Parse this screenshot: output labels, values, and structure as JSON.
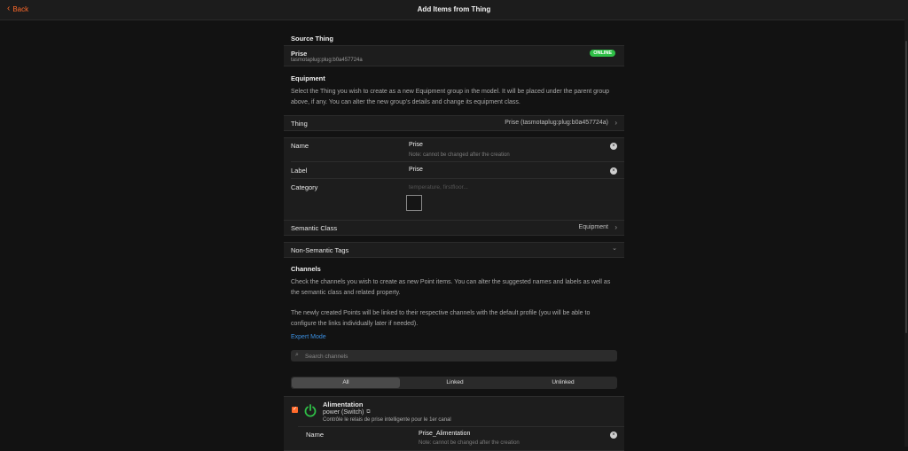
{
  "header": {
    "back_label": "Back",
    "title": "Add Items from Thing"
  },
  "source_thing": {
    "heading": "Source Thing",
    "name": "Prise",
    "uid": "tasmotaplug:plug:b0a457724a",
    "status": "ONLINE"
  },
  "equipment": {
    "heading": "Equipment",
    "description": "Select the Thing you wish to create as a new Equipment group in the model. It will be placed under the parent group above, if any. You can alter the new group's details and change its equipment class.",
    "thing_label": "Thing",
    "thing_value": "Prise (tasmotaplug:plug:b0a457724a)",
    "name_label": "Name",
    "name_value": "Prise",
    "name_note": "Note: cannot be changed after the creation",
    "label_label": "Label",
    "label_value": "Prise",
    "category_label": "Category",
    "category_placeholder": "temperature, firstfloor...",
    "semantic_class_label": "Semantic Class",
    "semantic_class_value": "Equipment",
    "non_semantic_tags_label": "Non-Semantic Tags"
  },
  "channels": {
    "heading": "Channels",
    "description1": "Check the channels you wish to create as new Point items. You can alter the suggested names and labels as well as the semantic class and related property.",
    "description2": "The newly created Points will be linked to their respective channels with the default profile (you will be able to configure the links individually later if needed).",
    "expert_mode": "Expert Mode",
    "search_placeholder": "Search channels",
    "filters": [
      "All",
      "Linked",
      "Unlinked"
    ],
    "items": [
      {
        "title": "Alimentation",
        "type": "power (Switch)",
        "description": "Contrôle le relais de prise intelligente pour le 1er canal",
        "name_label": "Name",
        "name_value": "Prise_Alimentation",
        "name_note": "Note: cannot be changed after the creation"
      }
    ]
  },
  "colors": {
    "accent": "#ff6a2b",
    "online": "#2fbf47",
    "link": "#3b8fe0"
  },
  "icons": {
    "back": "chevron-left-icon",
    "arrow": "chevron-right-icon",
    "expand": "chevron-down-icon",
    "clear": "close-circle-icon",
    "search": "search-icon",
    "power": "power-icon",
    "copy": "copy-icon"
  }
}
